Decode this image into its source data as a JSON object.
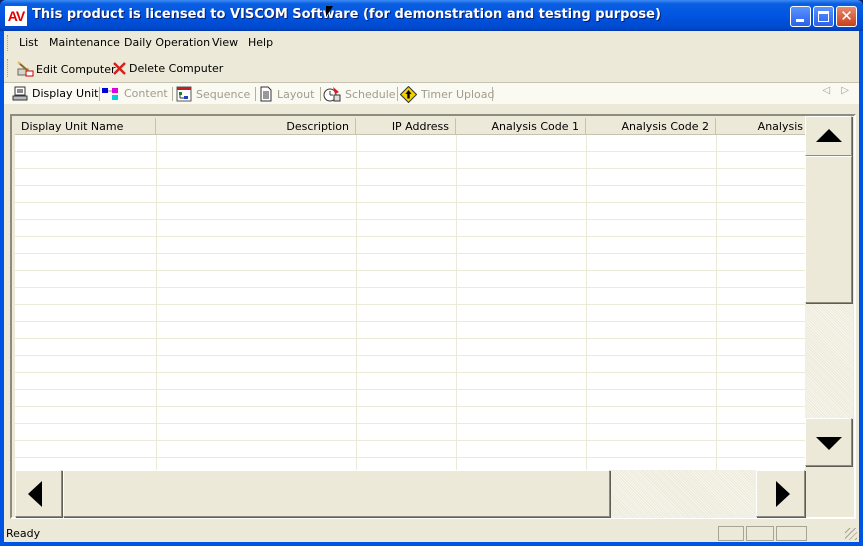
{
  "window": {
    "app_icon_text": "AV",
    "title": "This product is licensed to VISCOM Software (for demonstration and testing purpose)",
    "controls": {
      "minimize": "minimize",
      "maximize": "maximize",
      "close": "✕"
    }
  },
  "menubar": {
    "items": [
      {
        "label": "List"
      },
      {
        "label": "Maintenance"
      },
      {
        "label": "Daily Operation"
      },
      {
        "label": "View"
      },
      {
        "label": "Help"
      }
    ]
  },
  "toolbar": {
    "edit_label": "Edit Computer",
    "edit_icon": "edit-computer-icon",
    "delete_label": "Delete Computer",
    "delete_icon": "delete-x-icon",
    "delete_color": "#d42020"
  },
  "tabs": {
    "items": [
      {
        "label": "Display Unit",
        "icon": "computer-icon",
        "active": true
      },
      {
        "label": "Content",
        "icon": "content-icon",
        "active": false
      },
      {
        "label": "Sequence",
        "icon": "sequence-icon",
        "active": false
      },
      {
        "label": "Layout",
        "icon": "document-icon",
        "active": false
      },
      {
        "label": "Schedule",
        "icon": "schedule-icon",
        "active": false
      },
      {
        "label": "Timer Upload",
        "icon": "timer-upload-icon",
        "active": false
      }
    ],
    "scroll_arrows": "◁ ▷"
  },
  "grid": {
    "columns": [
      {
        "label": "Display Unit Name",
        "align": "left"
      },
      {
        "label": "Description",
        "align": "right"
      },
      {
        "label": "IP Address",
        "align": "right"
      },
      {
        "label": "Analysis Code 1",
        "align": "right"
      },
      {
        "label": "Analysis Code 2",
        "align": "right"
      },
      {
        "label": "Analysis",
        "align": "right"
      }
    ],
    "rows": []
  },
  "statusbar": {
    "text": "Ready"
  },
  "colors": {
    "titlebar": "#0054e3",
    "client_bg": "#ece9d8",
    "tab_bg": "#fbfaf2",
    "inactive_tab_text": "#a09c8c"
  }
}
